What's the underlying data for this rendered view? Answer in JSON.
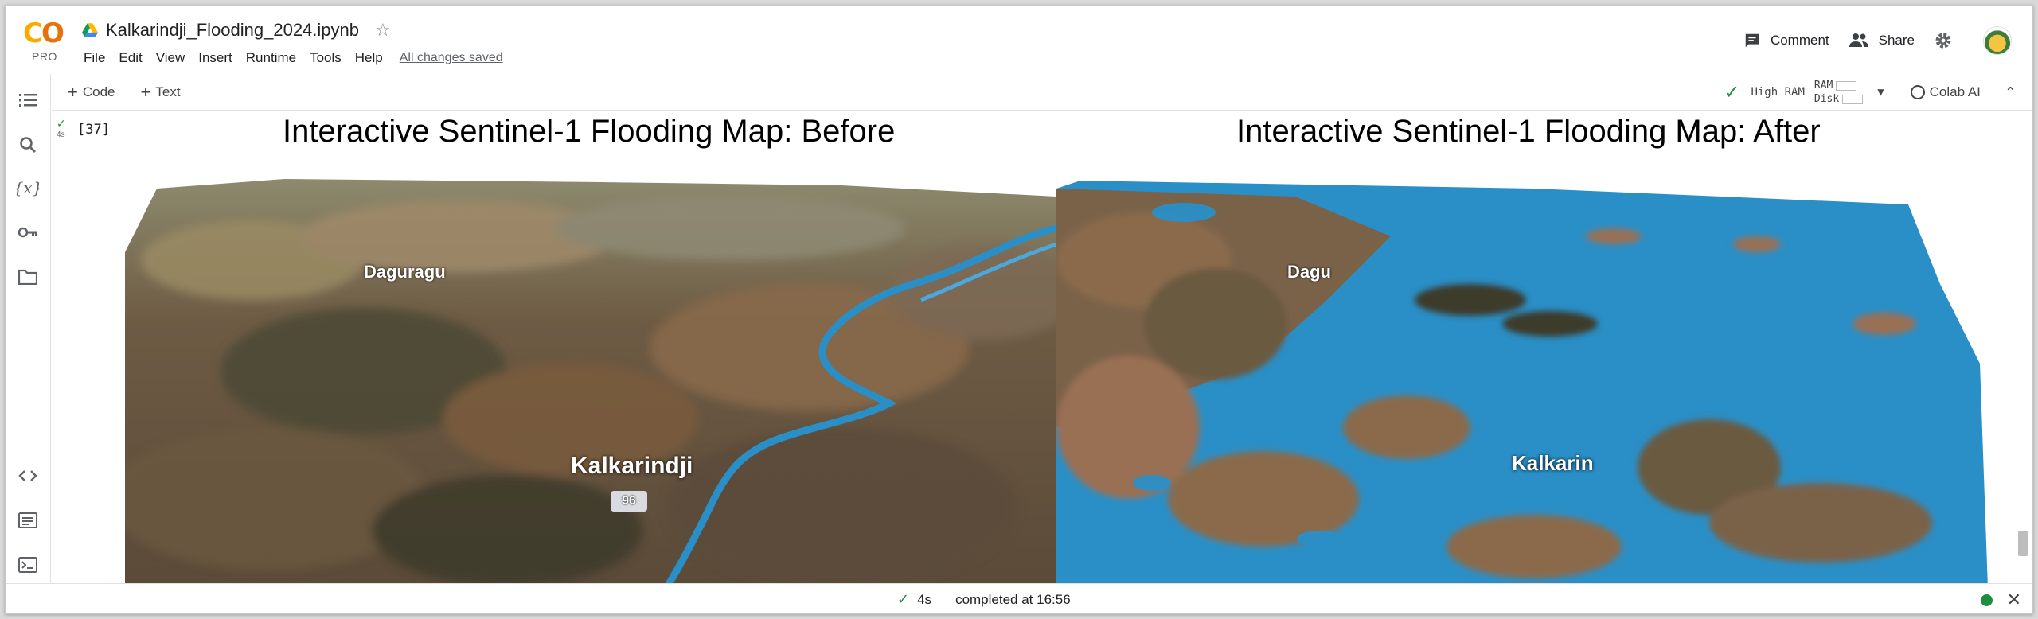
{
  "app": {
    "logo_text": "CO",
    "logo_tier": "PRO",
    "notebook_title": "Kalkarindji_Flooding_2024.ipynb",
    "save_status": "All changes saved",
    "menu": [
      "File",
      "Edit",
      "View",
      "Insert",
      "Runtime",
      "Tools",
      "Help"
    ]
  },
  "header_actions": {
    "comment_label": "Comment",
    "share_label": "Share"
  },
  "toolbar": {
    "add_code_label": "Code",
    "add_text_label": "Text",
    "runtime_label": "High RAM",
    "ram_label": "RAM",
    "disk_label": "Disk",
    "colab_ai_label": "Colab AI"
  },
  "sidebar": {
    "icons": [
      "table-of-contents-icon",
      "search-icon",
      "variables-icon",
      "secrets-key-icon",
      "files-folder-icon",
      "code-snippets-icon",
      "command-palette-icon",
      "terminal-icon"
    ]
  },
  "cell": {
    "execution_count": "[37]",
    "run_duration": "4s",
    "output": {
      "before_title": "Interactive Sentinel-1 Flooding Map: Before",
      "after_title": "Interactive Sentinel-1 Flooding Map: After",
      "before_labels": [
        "Daguragu",
        "Kalkarindji",
        "96"
      ],
      "after_labels": [
        "Dagu",
        "Kalkarin"
      ]
    }
  },
  "statusbar": {
    "duration": "4s",
    "completed_text": "completed at 16:56"
  },
  "colors": {
    "flood_blue": "#2a8fc7",
    "terrain_brown": "#8a6a4c",
    "terrain_dark": "#3e3a2a",
    "accent_green": "#1e8e3e",
    "logo_orange": "#f9ab00"
  }
}
